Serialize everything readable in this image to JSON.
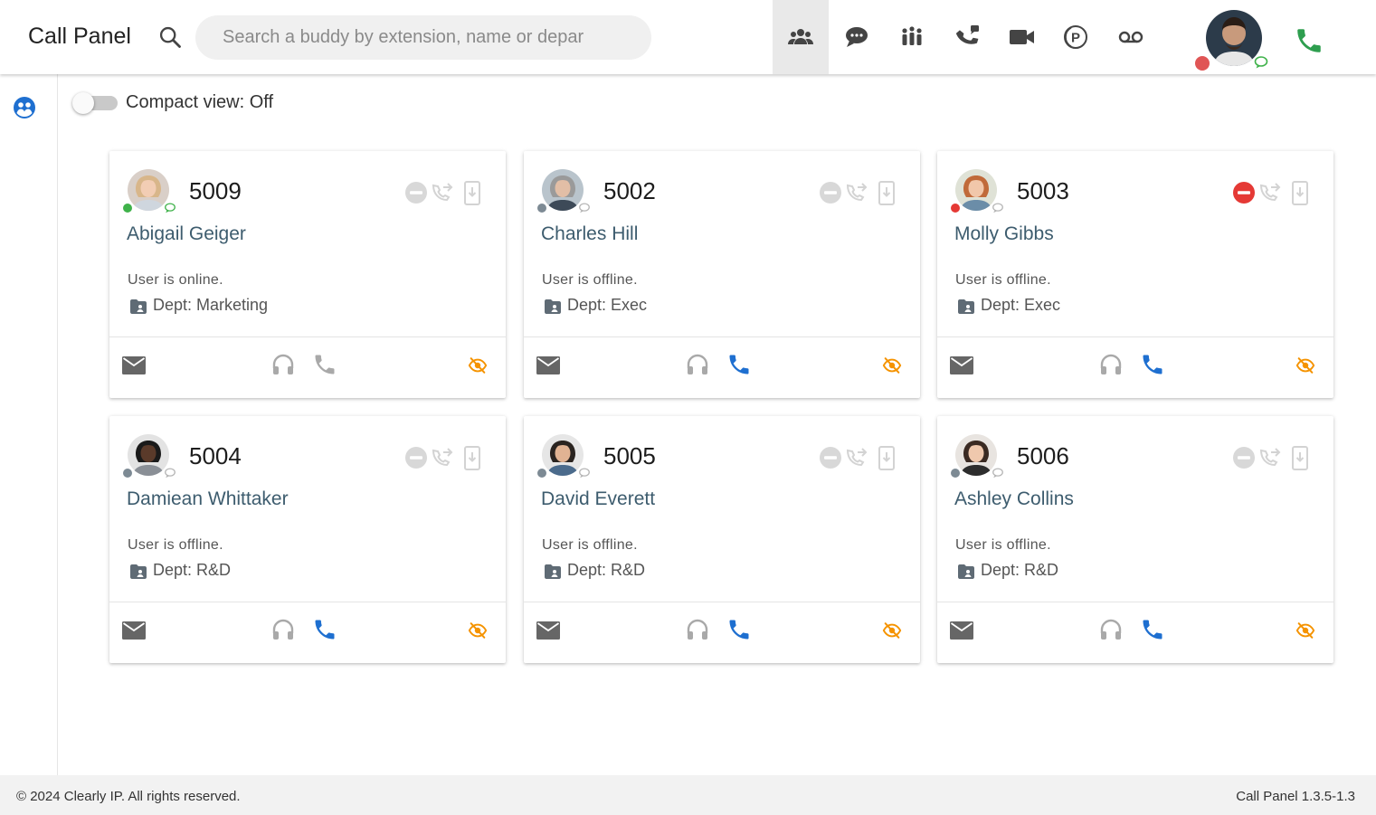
{
  "header": {
    "title": "Call Panel",
    "search_placeholder": "Search a buddy by extension, name or depar",
    "nav": [
      {
        "icon": "buddies-icon",
        "active": true
      },
      {
        "icon": "chat-icon",
        "active": false
      },
      {
        "icon": "groups-icon",
        "active": false
      },
      {
        "icon": "call-queue-icon",
        "active": false
      },
      {
        "icon": "video-icon",
        "active": false
      },
      {
        "icon": "parking-icon",
        "active": false
      },
      {
        "icon": "voicemail-icon",
        "active": false
      }
    ]
  },
  "compact_view": {
    "label": "Compact view: Off",
    "on": false
  },
  "cards": [
    {
      "ext": "5009",
      "name": "Abigail Geiger",
      "state": "User is online.",
      "dept": "Dept: Marketing",
      "status": "online",
      "dnd": false,
      "phone_active": false
    },
    {
      "ext": "5002",
      "name": "Charles Hill",
      "state": "User is offline.",
      "dept": "Dept: Exec",
      "status": "offline",
      "dnd": false,
      "phone_active": true
    },
    {
      "ext": "5003",
      "name": "Molly Gibbs",
      "state": "User is offline.",
      "dept": "Dept: Exec",
      "status": "busy",
      "dnd": true,
      "phone_active": true
    },
    {
      "ext": "5004",
      "name": "Damiean Whittaker",
      "state": "User is offline.",
      "dept": "Dept: R&D",
      "status": "offline",
      "dnd": false,
      "phone_active": true
    },
    {
      "ext": "5005",
      "name": "David Everett",
      "state": "User is offline.",
      "dept": "Dept: R&D",
      "status": "offline",
      "dnd": false,
      "phone_active": true
    },
    {
      "ext": "5006",
      "name": "Ashley Collins",
      "state": "User is offline.",
      "dept": "Dept: R&D",
      "status": "offline",
      "dnd": false,
      "phone_active": true
    }
  ],
  "footer": {
    "copyright": "© 2024 Clearly IP. All rights reserved.",
    "version": "Call Panel 1.3.5-1.3"
  },
  "colors": {
    "accent_blue": "#1e6fd0",
    "call_green": "#2e9e4f",
    "online_green": "#3fb24a",
    "offline_gray": "#7d8a94",
    "busy_red": "#e53935",
    "eye_off_orange": "#f59300",
    "name_color": "#3d5c6e"
  }
}
